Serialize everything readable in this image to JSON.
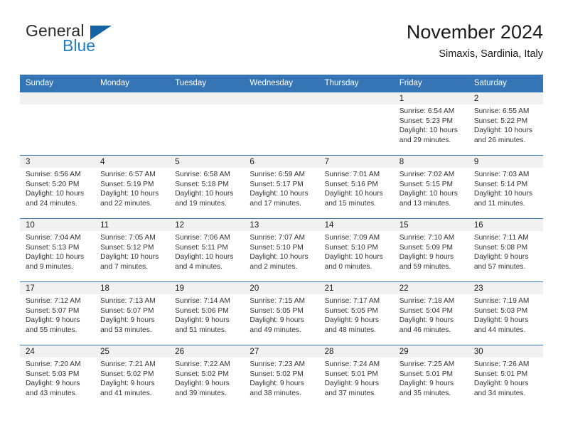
{
  "brand": {
    "name_part1": "General",
    "name_part2": "Blue",
    "logo_icon": "triangle-icon"
  },
  "header": {
    "title": "November 2024",
    "subtitle": "Simaxis, Sardinia, Italy"
  },
  "colors": {
    "header_blue": "#3575b5",
    "brand_blue": "#1f7fc4",
    "logo_triangle": "#1464a5",
    "daystrip_gray": "#f1f1f1"
  },
  "weekday_headers": [
    "Sunday",
    "Monday",
    "Tuesday",
    "Wednesday",
    "Thursday",
    "Friday",
    "Saturday"
  ],
  "weeks": [
    [
      {
        "day": "",
        "sunrise": "",
        "sunset": "",
        "daylight_line1": "",
        "daylight_line2": "",
        "blank": true
      },
      {
        "day": "",
        "sunrise": "",
        "sunset": "",
        "daylight_line1": "",
        "daylight_line2": "",
        "blank": true
      },
      {
        "day": "",
        "sunrise": "",
        "sunset": "",
        "daylight_line1": "",
        "daylight_line2": "",
        "blank": true
      },
      {
        "day": "",
        "sunrise": "",
        "sunset": "",
        "daylight_line1": "",
        "daylight_line2": "",
        "blank": true
      },
      {
        "day": "",
        "sunrise": "",
        "sunset": "",
        "daylight_line1": "",
        "daylight_line2": "",
        "blank": true
      },
      {
        "day": "1",
        "sunrise": "Sunrise: 6:54 AM",
        "sunset": "Sunset: 5:23 PM",
        "daylight_line1": "Daylight: 10 hours",
        "daylight_line2": "and 29 minutes.",
        "blank": false
      },
      {
        "day": "2",
        "sunrise": "Sunrise: 6:55 AM",
        "sunset": "Sunset: 5:22 PM",
        "daylight_line1": "Daylight: 10 hours",
        "daylight_line2": "and 26 minutes.",
        "blank": false
      }
    ],
    [
      {
        "day": "3",
        "sunrise": "Sunrise: 6:56 AM",
        "sunset": "Sunset: 5:20 PM",
        "daylight_line1": "Daylight: 10 hours",
        "daylight_line2": "and 24 minutes.",
        "blank": false
      },
      {
        "day": "4",
        "sunrise": "Sunrise: 6:57 AM",
        "sunset": "Sunset: 5:19 PM",
        "daylight_line1": "Daylight: 10 hours",
        "daylight_line2": "and 22 minutes.",
        "blank": false
      },
      {
        "day": "5",
        "sunrise": "Sunrise: 6:58 AM",
        "sunset": "Sunset: 5:18 PM",
        "daylight_line1": "Daylight: 10 hours",
        "daylight_line2": "and 19 minutes.",
        "blank": false
      },
      {
        "day": "6",
        "sunrise": "Sunrise: 6:59 AM",
        "sunset": "Sunset: 5:17 PM",
        "daylight_line1": "Daylight: 10 hours",
        "daylight_line2": "and 17 minutes.",
        "blank": false
      },
      {
        "day": "7",
        "sunrise": "Sunrise: 7:01 AM",
        "sunset": "Sunset: 5:16 PM",
        "daylight_line1": "Daylight: 10 hours",
        "daylight_line2": "and 15 minutes.",
        "blank": false
      },
      {
        "day": "8",
        "sunrise": "Sunrise: 7:02 AM",
        "sunset": "Sunset: 5:15 PM",
        "daylight_line1": "Daylight: 10 hours",
        "daylight_line2": "and 13 minutes.",
        "blank": false
      },
      {
        "day": "9",
        "sunrise": "Sunrise: 7:03 AM",
        "sunset": "Sunset: 5:14 PM",
        "daylight_line1": "Daylight: 10 hours",
        "daylight_line2": "and 11 minutes.",
        "blank": false
      }
    ],
    [
      {
        "day": "10",
        "sunrise": "Sunrise: 7:04 AM",
        "sunset": "Sunset: 5:13 PM",
        "daylight_line1": "Daylight: 10 hours",
        "daylight_line2": "and 9 minutes.",
        "blank": false
      },
      {
        "day": "11",
        "sunrise": "Sunrise: 7:05 AM",
        "sunset": "Sunset: 5:12 PM",
        "daylight_line1": "Daylight: 10 hours",
        "daylight_line2": "and 7 minutes.",
        "blank": false
      },
      {
        "day": "12",
        "sunrise": "Sunrise: 7:06 AM",
        "sunset": "Sunset: 5:11 PM",
        "daylight_line1": "Daylight: 10 hours",
        "daylight_line2": "and 4 minutes.",
        "blank": false
      },
      {
        "day": "13",
        "sunrise": "Sunrise: 7:07 AM",
        "sunset": "Sunset: 5:10 PM",
        "daylight_line1": "Daylight: 10 hours",
        "daylight_line2": "and 2 minutes.",
        "blank": false
      },
      {
        "day": "14",
        "sunrise": "Sunrise: 7:09 AM",
        "sunset": "Sunset: 5:10 PM",
        "daylight_line1": "Daylight: 10 hours",
        "daylight_line2": "and 0 minutes.",
        "blank": false
      },
      {
        "day": "15",
        "sunrise": "Sunrise: 7:10 AM",
        "sunset": "Sunset: 5:09 PM",
        "daylight_line1": "Daylight: 9 hours",
        "daylight_line2": "and 59 minutes.",
        "blank": false
      },
      {
        "day": "16",
        "sunrise": "Sunrise: 7:11 AM",
        "sunset": "Sunset: 5:08 PM",
        "daylight_line1": "Daylight: 9 hours",
        "daylight_line2": "and 57 minutes.",
        "blank": false
      }
    ],
    [
      {
        "day": "17",
        "sunrise": "Sunrise: 7:12 AM",
        "sunset": "Sunset: 5:07 PM",
        "daylight_line1": "Daylight: 9 hours",
        "daylight_line2": "and 55 minutes.",
        "blank": false
      },
      {
        "day": "18",
        "sunrise": "Sunrise: 7:13 AM",
        "sunset": "Sunset: 5:07 PM",
        "daylight_line1": "Daylight: 9 hours",
        "daylight_line2": "and 53 minutes.",
        "blank": false
      },
      {
        "day": "19",
        "sunrise": "Sunrise: 7:14 AM",
        "sunset": "Sunset: 5:06 PM",
        "daylight_line1": "Daylight: 9 hours",
        "daylight_line2": "and 51 minutes.",
        "blank": false
      },
      {
        "day": "20",
        "sunrise": "Sunrise: 7:15 AM",
        "sunset": "Sunset: 5:05 PM",
        "daylight_line1": "Daylight: 9 hours",
        "daylight_line2": "and 49 minutes.",
        "blank": false
      },
      {
        "day": "21",
        "sunrise": "Sunrise: 7:17 AM",
        "sunset": "Sunset: 5:05 PM",
        "daylight_line1": "Daylight: 9 hours",
        "daylight_line2": "and 48 minutes.",
        "blank": false
      },
      {
        "day": "22",
        "sunrise": "Sunrise: 7:18 AM",
        "sunset": "Sunset: 5:04 PM",
        "daylight_line1": "Daylight: 9 hours",
        "daylight_line2": "and 46 minutes.",
        "blank": false
      },
      {
        "day": "23",
        "sunrise": "Sunrise: 7:19 AM",
        "sunset": "Sunset: 5:03 PM",
        "daylight_line1": "Daylight: 9 hours",
        "daylight_line2": "and 44 minutes.",
        "blank": false
      }
    ],
    [
      {
        "day": "24",
        "sunrise": "Sunrise: 7:20 AM",
        "sunset": "Sunset: 5:03 PM",
        "daylight_line1": "Daylight: 9 hours",
        "daylight_line2": "and 43 minutes.",
        "blank": false
      },
      {
        "day": "25",
        "sunrise": "Sunrise: 7:21 AM",
        "sunset": "Sunset: 5:02 PM",
        "daylight_line1": "Daylight: 9 hours",
        "daylight_line2": "and 41 minutes.",
        "blank": false
      },
      {
        "day": "26",
        "sunrise": "Sunrise: 7:22 AM",
        "sunset": "Sunset: 5:02 PM",
        "daylight_line1": "Daylight: 9 hours",
        "daylight_line2": "and 39 minutes.",
        "blank": false
      },
      {
        "day": "27",
        "sunrise": "Sunrise: 7:23 AM",
        "sunset": "Sunset: 5:02 PM",
        "daylight_line1": "Daylight: 9 hours",
        "daylight_line2": "and 38 minutes.",
        "blank": false
      },
      {
        "day": "28",
        "sunrise": "Sunrise: 7:24 AM",
        "sunset": "Sunset: 5:01 PM",
        "daylight_line1": "Daylight: 9 hours",
        "daylight_line2": "and 37 minutes.",
        "blank": false
      },
      {
        "day": "29",
        "sunrise": "Sunrise: 7:25 AM",
        "sunset": "Sunset: 5:01 PM",
        "daylight_line1": "Daylight: 9 hours",
        "daylight_line2": "and 35 minutes.",
        "blank": false
      },
      {
        "day": "30",
        "sunrise": "Sunrise: 7:26 AM",
        "sunset": "Sunset: 5:01 PM",
        "daylight_line1": "Daylight: 9 hours",
        "daylight_line2": "and 34 minutes.",
        "blank": false
      }
    ]
  ]
}
